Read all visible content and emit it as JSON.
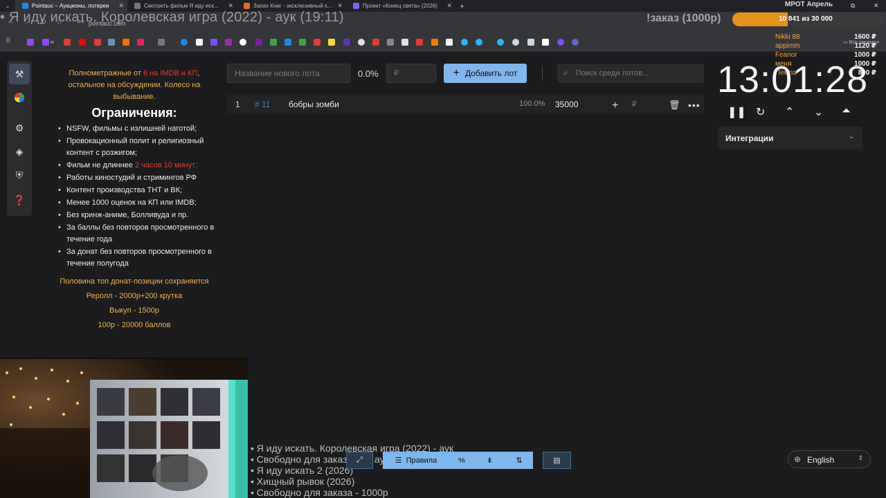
{
  "browser": {
    "tabs": [
      {
        "title": "Pointauc – Аукционы, лотереи",
        "active": true,
        "color": "#1e88e5"
      },
      {
        "title": "Смотреть фильм Я иду иск...",
        "active": false,
        "color": "#888888"
      },
      {
        "title": "Запах Книг - эксклюзивный к...",
        "active": false,
        "color": "#e6692e"
      },
      {
        "title": "Проект «Конец света» (2026)",
        "active": false,
        "color": "#7b61ff"
      }
    ],
    "url": "pointauc.com",
    "all_bookmarks": "Все закладки"
  },
  "overlay": {
    "stream_title": "• Я иду искать. Королевская игра (2022) - аук (19:11)",
    "order_label": "!заказ (1000р)",
    "goal_label": "МРОТ Апрель",
    "goal_progress": "10 841  из 30 000",
    "goal_fraction": 0.36,
    "donors": [
      {
        "name": "Nikki 88",
        "amount": "1600 ₽"
      },
      {
        "name": "appimm",
        "amount": "1120 ₽"
      },
      {
        "name": "Feanor",
        "amount": "1000 ₽"
      },
      {
        "name": "меня",
        "amount": "1000 ₽"
      },
      {
        "name": "Пемпа",
        "amount": "800 ₽"
      }
    ]
  },
  "rules": {
    "intro_a": "Полнометражные от ",
    "intro_red": "6 на IMDB и КП",
    "intro_b": ", остальное на обсуждении. Колесо на выбывание.",
    "heading": "Ограничения:",
    "items": [
      "NSFW, фильмы с излишней наготой;",
      "Провокационный полит и религиозный контент с розжигом;",
      "Фильм не длиннее ",
      "Работы киностудий и стримингов РФ",
      "Контент производства ТНТ и ВК;",
      "Менее 1000 оценок на КП или IMDB;",
      "Без кринж-аниме, Болливуда и пр.",
      "За баллы без повторов просмотренного в течение года",
      "За донат без повторов просмотренного в течение полугода"
    ],
    "duration_red": "2 часов 10 минут;",
    "notes": [
      "Половина топ донат-позиции сохраняется",
      "Реролл - 2000р+200 крутка",
      "Выкуп - 1500р",
      "100р - 20000 баллов"
    ]
  },
  "lot_form": {
    "name_placeholder": "Название нового лота",
    "percent": "0.0%",
    "price_placeholder": "₽",
    "add_button": "Добавить лот",
    "search_placeholder": "Поиск среди лотов..."
  },
  "lots": [
    {
      "index": "1",
      "id": "# 11",
      "name": "бобры зомби",
      "percent": "100.0%",
      "amount": "35000",
      "currency": "₽"
    }
  ],
  "timer": {
    "value": "13:01:28",
    "integrations": "Интеграции"
  },
  "queue": [
    "• Я иду искать. Королевская игра (2022) - аук",
    "• Свободно для заказа или аук",
    "• Я иду искать 2 (2026)",
    "• Хищный рывок (2026)",
    "• Свободно для заказа - 1000р"
  ],
  "toolbar": {
    "rules_label": "Правила",
    "percent_icon": "%"
  },
  "language": "English",
  "colors": {
    "accent": "#7fb6ec",
    "gold": "#f0b24a",
    "red": "#e0392c",
    "goal": "#e69219"
  }
}
